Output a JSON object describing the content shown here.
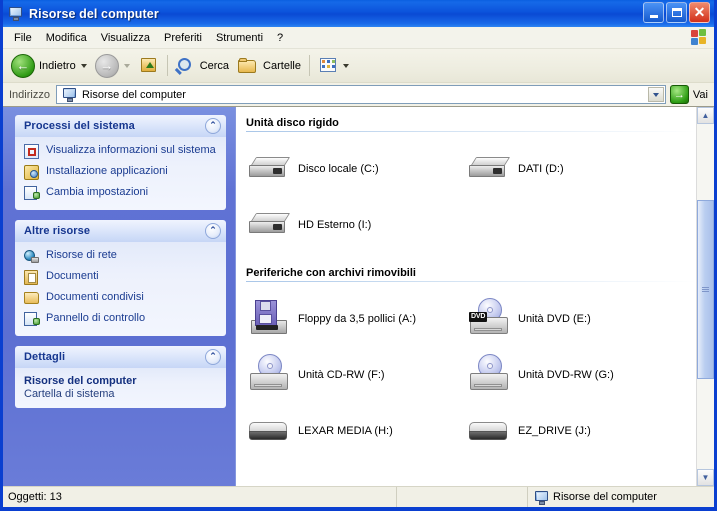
{
  "window": {
    "title": "Risorse del computer",
    "title_icon": "my-computer-icon",
    "buttons": {
      "minimize": "_",
      "maximize": "□",
      "close": "✕"
    }
  },
  "menu": {
    "items": [
      {
        "label": "File"
      },
      {
        "label": "Modifica"
      },
      {
        "label": "Visualizza"
      },
      {
        "label": "Preferiti"
      },
      {
        "label": "Strumenti"
      },
      {
        "label": "?"
      }
    ]
  },
  "toolbar": {
    "back": {
      "label": "Indietro",
      "icon": "back-arrow-icon"
    },
    "forward": {
      "label": "",
      "icon": "forward-arrow-icon"
    },
    "up": {
      "label": "",
      "icon": "up-folder-icon"
    },
    "search": {
      "label": "Cerca",
      "icon": "search-icon"
    },
    "folders": {
      "label": "Cartelle",
      "icon": "folders-icon"
    },
    "views": {
      "label": "",
      "icon": "views-icon"
    }
  },
  "address": {
    "label": "Indirizzo",
    "value": "Risorse del computer",
    "icon": "my-computer-icon",
    "go_label": "Vai",
    "go_icon": "go-arrow-icon"
  },
  "sidebar": {
    "panels": [
      {
        "title": "Processi del sistema",
        "collapse_icon": "chevron-up-icon",
        "items": [
          {
            "label": "Visualizza informazioni sul sistema",
            "icon": "system-info-icon"
          },
          {
            "label": "Installazione applicazioni",
            "icon": "add-remove-programs-icon"
          },
          {
            "label": "Cambia impostazioni",
            "icon": "change-settings-icon"
          }
        ]
      },
      {
        "title": "Altre risorse",
        "collapse_icon": "chevron-up-icon",
        "items": [
          {
            "label": "Risorse di rete",
            "icon": "network-icon"
          },
          {
            "label": "Documenti",
            "icon": "documents-icon"
          },
          {
            "label": "Documenti condivisi",
            "icon": "shared-documents-icon"
          },
          {
            "label": "Pannello di controllo",
            "icon": "control-panel-icon"
          }
        ]
      }
    ],
    "details": {
      "title": "Dettagli",
      "collapse_icon": "chevron-up-icon",
      "name": "Risorse del computer",
      "type": "Cartella di sistema"
    }
  },
  "main": {
    "sections": [
      {
        "title": "Unità disco rigido",
        "items": [
          {
            "label": "Disco locale (C:)",
            "icon": "hard-drive-icon"
          },
          {
            "label": "DATI (D:)",
            "icon": "hard-drive-icon"
          },
          {
            "label": "HD Esterno (I:)",
            "icon": "hard-drive-icon"
          }
        ]
      },
      {
        "title": "Periferiche con archivi rimovibili",
        "items": [
          {
            "label": "Floppy da 3,5 pollici (A:)",
            "icon": "floppy-drive-icon"
          },
          {
            "label": "Unità DVD (E:)",
            "icon": "dvd-drive-icon",
            "badge": "DVD"
          },
          {
            "label": "Unità CD-RW (F:)",
            "icon": "cd-drive-icon"
          },
          {
            "label": "Unità DVD-RW (G:)",
            "icon": "cd-drive-icon"
          },
          {
            "label": "LEXAR MEDIA (H:)",
            "icon": "removable-drive-icon"
          },
          {
            "label": "EZ_DRIVE (J:)",
            "icon": "removable-drive-icon"
          }
        ]
      }
    ]
  },
  "scrollbar": {
    "up": "▲",
    "down": "▼"
  },
  "status": {
    "objects": "Oggetti: 13",
    "location": "Risorse del computer",
    "location_icon": "my-computer-icon"
  },
  "colors": {
    "titlebar_blue": "#0C54DC",
    "sidebar_blue": "#6072D4",
    "panel_header": "#DDE7FB",
    "link_blue": "#1B3C91",
    "toolbar_cream": "#EEEDE0"
  }
}
